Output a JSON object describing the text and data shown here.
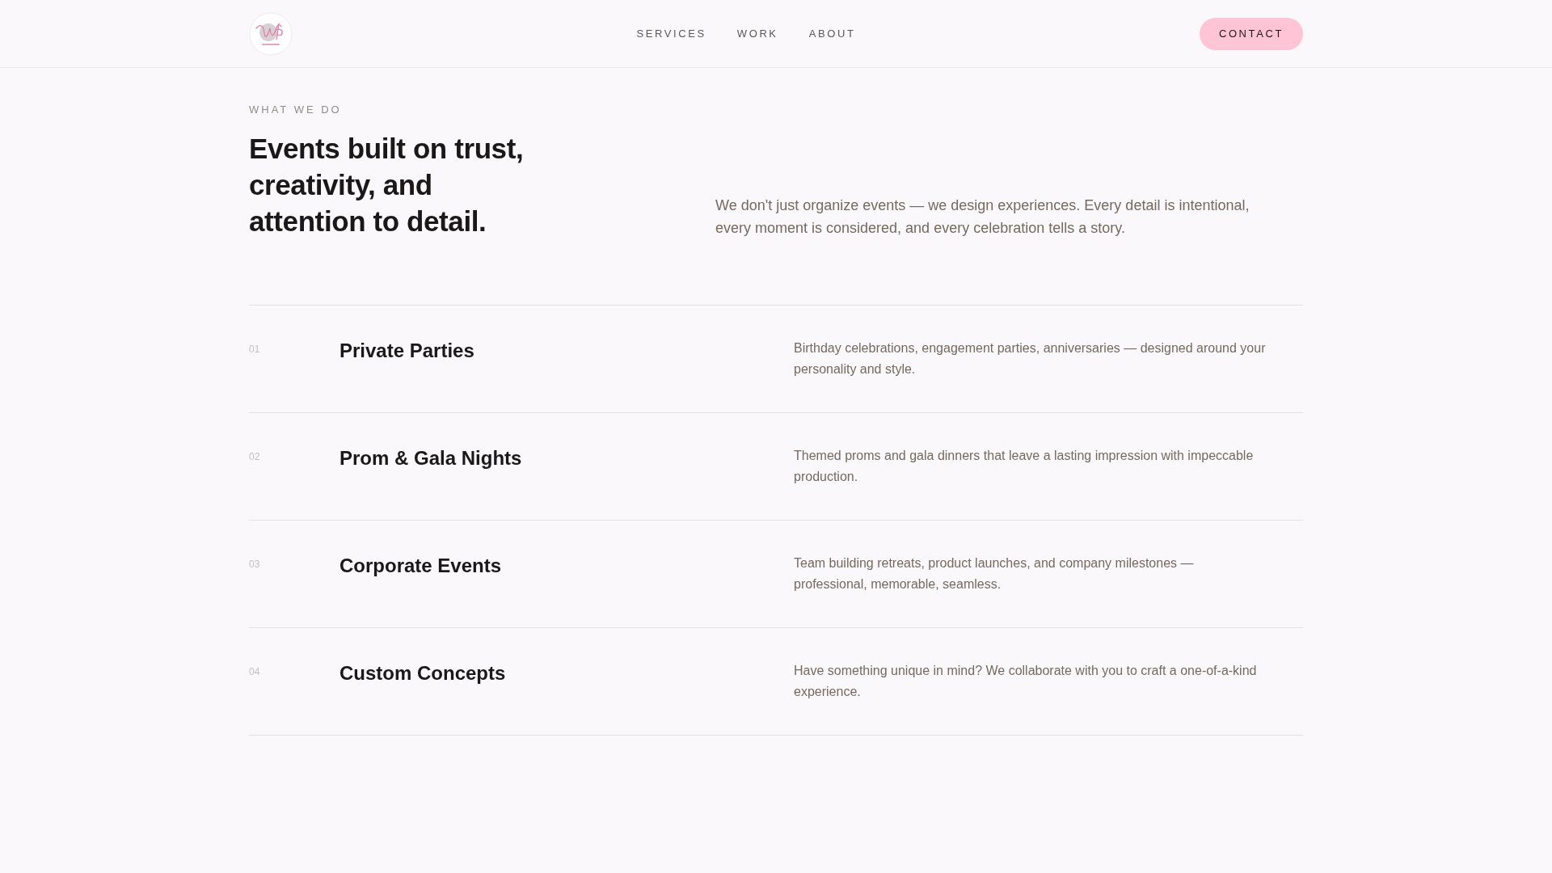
{
  "header": {
    "nav": [
      {
        "label": "SERVICES"
      },
      {
        "label": "WORK"
      },
      {
        "label": "ABOUT"
      }
    ],
    "cta": {
      "label": "CONTACT"
    }
  },
  "intro": {
    "eyebrow": "WHAT WE DO",
    "heading": "Events built on trust, creativity, and attention to detail.",
    "description": "We don't just organize events — we design experiences. Every detail is intentional, every moment is considered, and every celebration tells a story."
  },
  "services": [
    {
      "number": "01",
      "title": "Private Parties",
      "description": "Birthday celebrations, engagement parties, anniversaries — designed around your personality and style."
    },
    {
      "number": "02",
      "title": "Prom & Gala Nights",
      "description": "Themed proms and gala dinners that leave a lasting impression with impeccable production."
    },
    {
      "number": "03",
      "title": "Corporate Events",
      "description": "Team building retreats, product launches, and company milestones — professional, memorable, seamless."
    },
    {
      "number": "04",
      "title": "Custom Concepts",
      "description": "Have something unique in mind? We collaborate with you to craft a one-of-a-kind experience."
    }
  ]
}
